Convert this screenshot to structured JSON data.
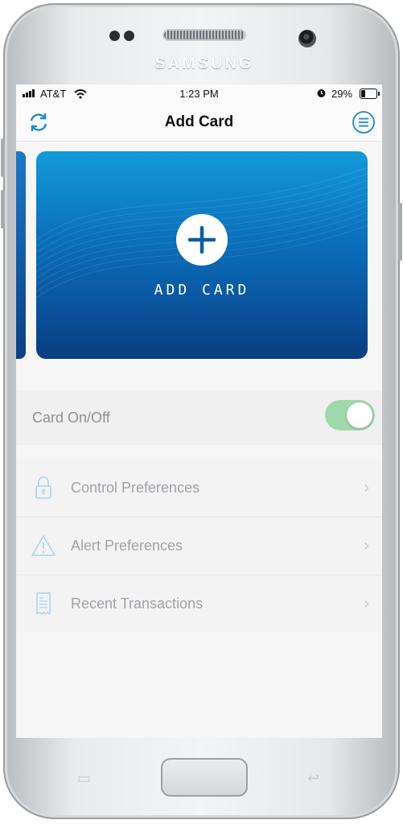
{
  "device": {
    "brand": "SAMSUNG"
  },
  "status_bar": {
    "carrier": "AT&T",
    "time": "1:23 PM",
    "battery": "29%"
  },
  "nav": {
    "title": "Add Card",
    "refresh_icon": "refresh-icon",
    "menu_icon": "menu-icon"
  },
  "card": {
    "label": "ADD CARD",
    "icon": "plus-icon"
  },
  "toggle": {
    "label": "Card On/Off",
    "on": true,
    "on_color": "#9fd9ab"
  },
  "menu": {
    "items": [
      {
        "label": "Control Preferences",
        "icon": "lock-icon"
      },
      {
        "label": "Alert Preferences",
        "icon": "warning-icon"
      },
      {
        "label": "Recent Transactions",
        "icon": "receipt-icon"
      }
    ]
  },
  "colors": {
    "accent": "#1b87d6",
    "card_top": "#139ad9",
    "card_bottom": "#093e80"
  }
}
